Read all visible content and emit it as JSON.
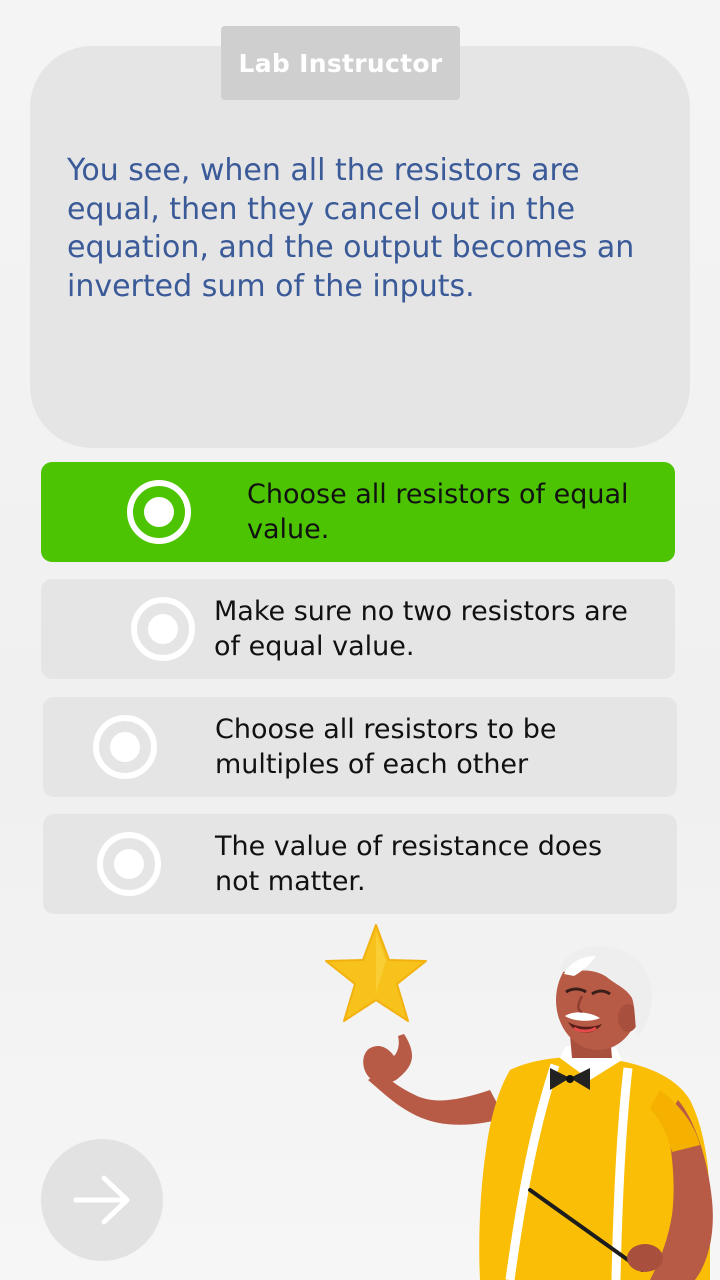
{
  "speech": {
    "speaker": "Lab Instructor",
    "text": "You see, when all the resistors are equal, then they cancel out in the equation, and the output becomes an inverted sum of the inputs."
  },
  "options": [
    {
      "label": "Choose all resistors of equal value.",
      "selected": true
    },
    {
      "label": "Make sure no two resistors are of equal value.",
      "selected": false
    },
    {
      "label": "Choose all resistors to be multiples of each other",
      "selected": false
    },
    {
      "label": "The value of resistance does not matter.",
      "selected": false
    }
  ],
  "next_button": {
    "icon": "arrow-right-icon"
  },
  "illustration": {
    "star_icon": "star-icon",
    "character": "lab-instructor-character"
  },
  "colors": {
    "selected": "#4cc401",
    "option_bg": "#e6e5e6",
    "speech_text": "#3a5a98",
    "tag_bg": "#cfcfcf",
    "star": "#f7c21c"
  }
}
